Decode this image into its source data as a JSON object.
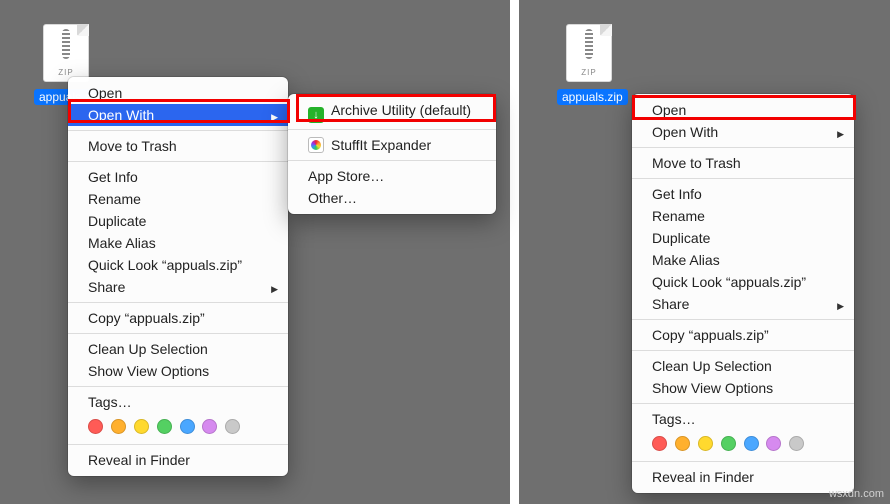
{
  "file": {
    "name": "appuals.zip",
    "ext": "ZIP"
  },
  "menu": {
    "open": "Open",
    "open_with": "Open With",
    "trash": "Move to Trash",
    "get_info": "Get Info",
    "rename": "Rename",
    "duplicate": "Duplicate",
    "make_alias": "Make Alias",
    "quick_look": "Quick Look “appuals.zip”",
    "share": "Share",
    "copy": "Copy “appuals.zip”",
    "clean_up": "Clean Up Selection",
    "view_opts": "Show View Options",
    "tags": "Tags…",
    "reveal": "Reveal in Finder"
  },
  "open_with_sub": {
    "archive_utility": "Archive Utility (default)",
    "stuffit": "StuffIt Expander",
    "app_store": "App Store…",
    "other": "Other…"
  },
  "watermark": "wsxdn.com"
}
